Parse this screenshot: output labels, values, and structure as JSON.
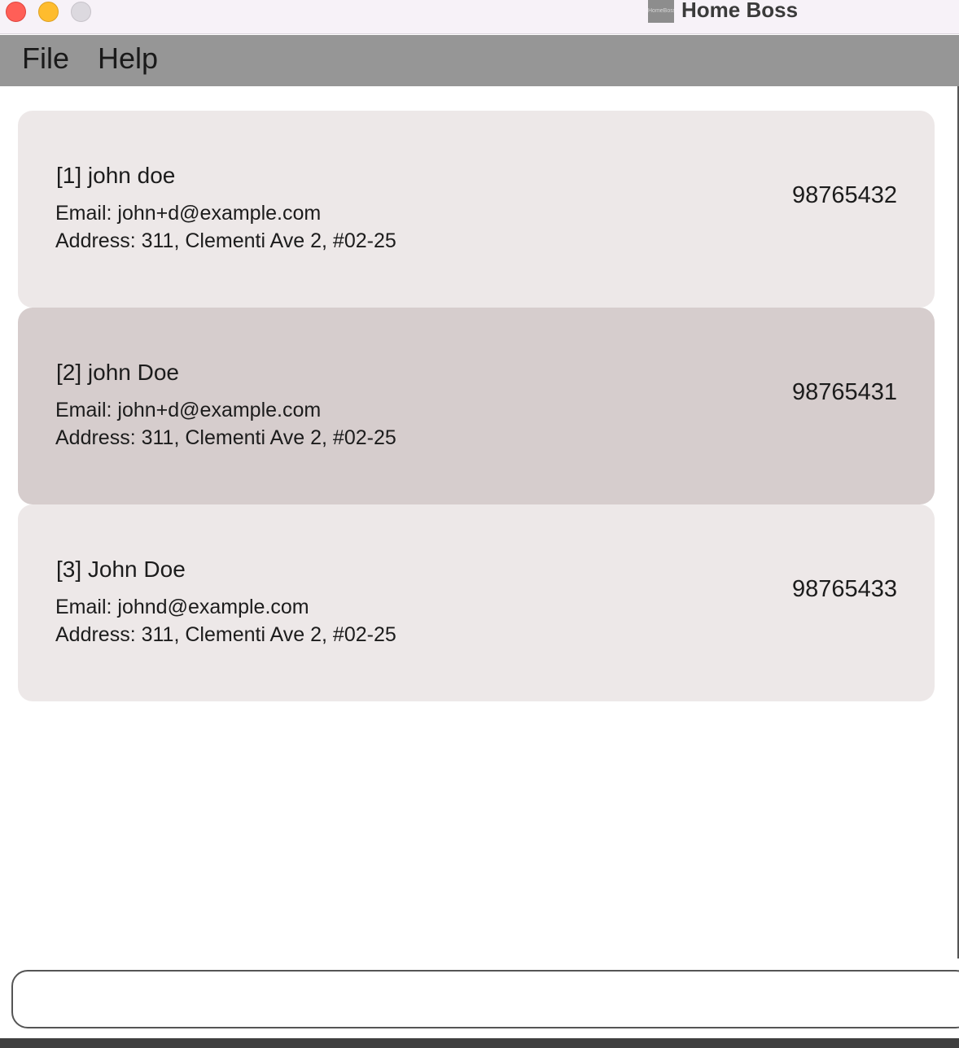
{
  "window": {
    "title": "Home Boss",
    "app_icon_text": "HomeBoss"
  },
  "menu": {
    "file_label": "File",
    "help_label": "Help"
  },
  "persons": [
    {
      "name": "[1] john doe",
      "email": "Email: john+d@example.com",
      "address": "Address: 311, Clementi Ave 2, #02-25",
      "phone": "98765432",
      "selected": false
    },
    {
      "name": "[2] john Doe",
      "email": "Email: john+d@example.com",
      "address": "Address: 311, Clementi Ave 2, #02-25",
      "phone": "98765431",
      "selected": true
    },
    {
      "name": "[3] John Doe",
      "email": "Email: johnd@example.com",
      "address": "Address: 311, Clementi Ave 2, #02-25",
      "phone": "98765433",
      "selected": false
    }
  ],
  "command": {
    "value": "",
    "placeholder": ""
  },
  "colors": {
    "card": "#ede8e8",
    "card_selected": "#d6cdcd",
    "menubar": "#969696"
  }
}
